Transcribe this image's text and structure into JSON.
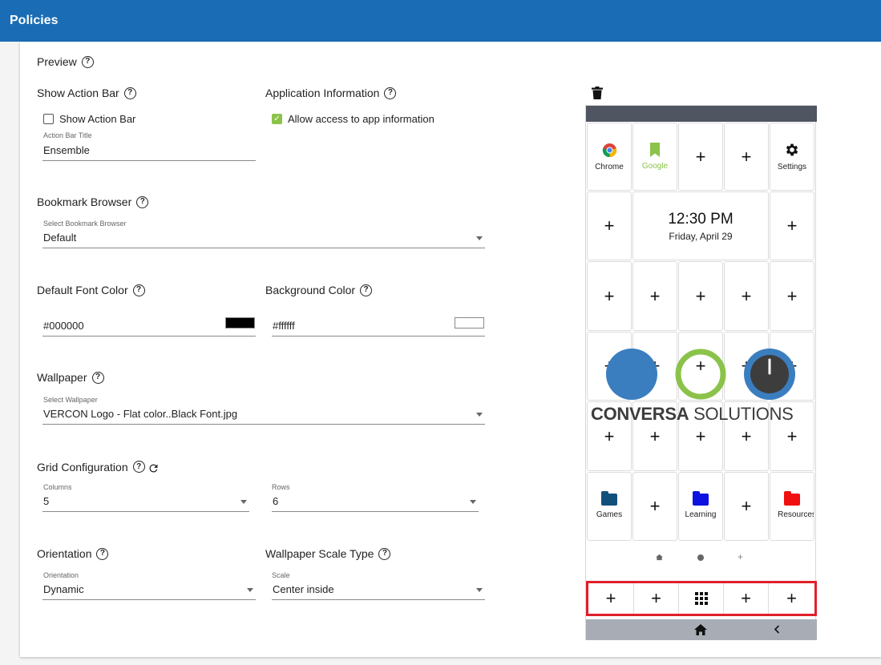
{
  "header": {
    "title": "Policies"
  },
  "preview": {
    "label": "Preview"
  },
  "action_bar": {
    "section_label": "Show Action Bar",
    "checkbox_label": "Show Action Bar",
    "checked": false,
    "title_field_label": "Action Bar Title",
    "title_value": "Ensemble"
  },
  "app_info": {
    "section_label": "Application Information",
    "checkbox_label": "Allow access to app information",
    "checked": true
  },
  "bookmark_browser": {
    "section_label": "Bookmark Browser",
    "field_label": "Select Bookmark Browser",
    "value": "Default"
  },
  "font_color": {
    "section_label": "Default Font Color",
    "value": "#000000",
    "swatch": "#000000"
  },
  "background_color": {
    "section_label": "Background Color",
    "value": "#ffffff",
    "swatch": "#ffffff"
  },
  "wallpaper": {
    "section_label": "Wallpaper",
    "field_label": "Select Wallpaper",
    "value": "VERCON Logo - Flat color..Black Font.jpg"
  },
  "grid": {
    "section_label": "Grid Configuration",
    "columns_label": "Columns",
    "columns_value": "5",
    "rows_label": "Rows",
    "rows_value": "6"
  },
  "orientation": {
    "section_label": "Orientation",
    "field_label": "Orientation",
    "value": "Dynamic"
  },
  "scale": {
    "section_label": "Wallpaper Scale Type",
    "field_label": "Scale",
    "value": "Center inside"
  },
  "phone": {
    "apps": {
      "chrome": "Chrome",
      "google": "Google",
      "settings": "Settings",
      "games": "Games",
      "learning": "Learning",
      "resources": "Resources"
    },
    "clock": {
      "time": "12:30 PM",
      "date": "Friday, April 29"
    },
    "plus": "+",
    "wallpaper_text": {
      "bold": "CONVERSA",
      "light": " SOLUTIONS"
    }
  },
  "colors": {
    "header_bg": "#1a6db5",
    "accent_green": "#8bc34a",
    "dock_border": "#e0202a",
    "games_folder": "#12507c",
    "learning_folder": "#0d12e0",
    "resources_folder": "#f01010",
    "logo_blue": "#3a7ebf"
  }
}
